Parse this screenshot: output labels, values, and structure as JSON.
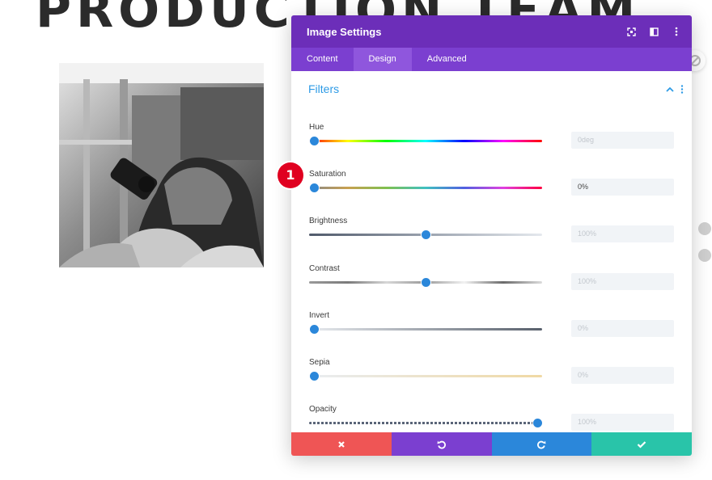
{
  "page": {
    "heading": "PRODUCTION TEAM"
  },
  "modal": {
    "title": "Image Settings",
    "header_icons": [
      "expand-icon",
      "split-view-icon",
      "more-options-icon"
    ],
    "tabs": [
      {
        "label": "Content",
        "active": false
      },
      {
        "label": "Design",
        "active": true
      },
      {
        "label": "Advanced",
        "active": false
      }
    ],
    "section": {
      "title": "Filters",
      "expanded": true
    },
    "filters": [
      {
        "label": "Hue",
        "value": "0deg",
        "level": 0.02,
        "track": "hue",
        "active": false
      },
      {
        "label": "Saturation",
        "value": "0%",
        "level": 0.02,
        "track": "saturation",
        "active": true
      },
      {
        "label": "Brightness",
        "value": "100%",
        "level": 0.5,
        "track": "brightness",
        "active": false
      },
      {
        "label": "Contrast",
        "value": "100%",
        "level": 0.5,
        "track": "contrast",
        "active": false
      },
      {
        "label": "Invert",
        "value": "0%",
        "level": 0.02,
        "track": "invert",
        "active": false
      },
      {
        "label": "Sepia",
        "value": "0%",
        "level": 0.02,
        "track": "sepia",
        "active": false
      },
      {
        "label": "Opacity",
        "value": "100%",
        "level": 0.98,
        "track": "opacity",
        "active": false
      }
    ],
    "annotation_badge": "1",
    "footer": {
      "buttons": [
        {
          "name": "discard",
          "icon": "close-icon",
          "color": "#ef5555"
        },
        {
          "name": "undo",
          "icon": "undo-icon",
          "color": "#7b3fd0"
        },
        {
          "name": "redo",
          "icon": "redo-icon",
          "color": "#2b87da"
        },
        {
          "name": "save",
          "icon": "check-icon",
          "color": "#29c4a9"
        }
      ]
    }
  },
  "colors": {
    "header": "#6c2eb9",
    "tabs": "#7b3fd0",
    "active_tab": "#8f56dd",
    "accent": "#2e9be6",
    "thumb": "#2b87da"
  }
}
